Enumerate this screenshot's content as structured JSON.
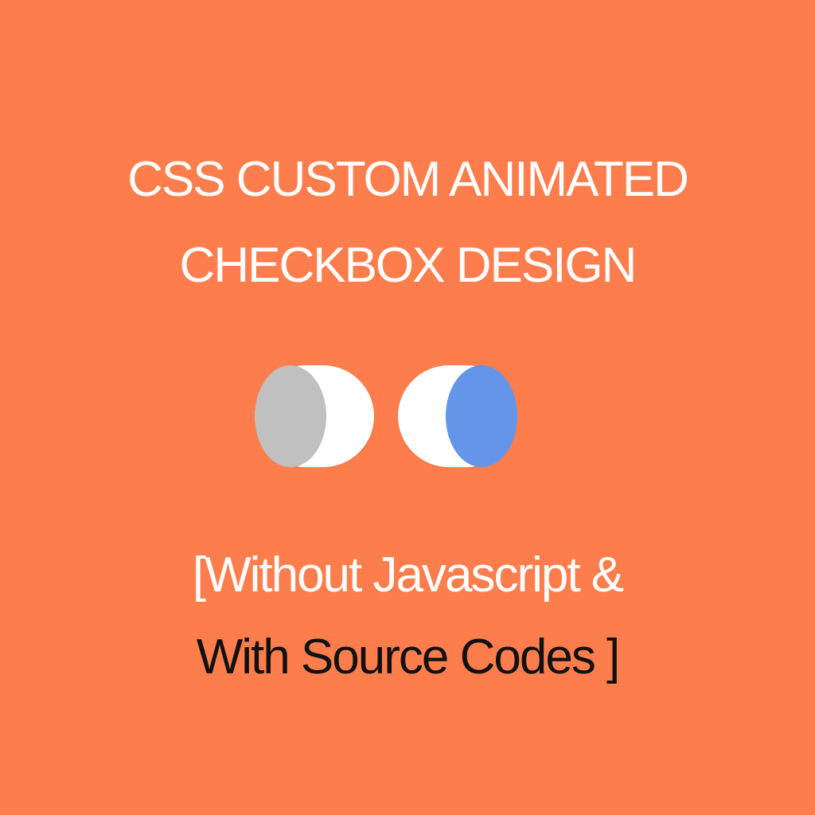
{
  "colors": {
    "background": "#fe7d4c",
    "title_text": "#ffffff",
    "subtitle_line1_text": "#ffffff",
    "subtitle_line2_text": "#111111",
    "toggle_track": "#ffffff",
    "toggle_off_knob": "#c0c0c0",
    "toggle_on_knob": "#6495e8"
  },
  "title": {
    "line1": "CSS CUSTOM ANIMATED",
    "line2": "CHECKBOX DESIGN"
  },
  "toggles": [
    {
      "state": "off",
      "icon": "toggle-switch-icon"
    },
    {
      "state": "on",
      "icon": "toggle-switch-icon"
    }
  ],
  "subtitle": {
    "line1": "[Without Javascript &",
    "line2": "With Source Codes ]"
  }
}
